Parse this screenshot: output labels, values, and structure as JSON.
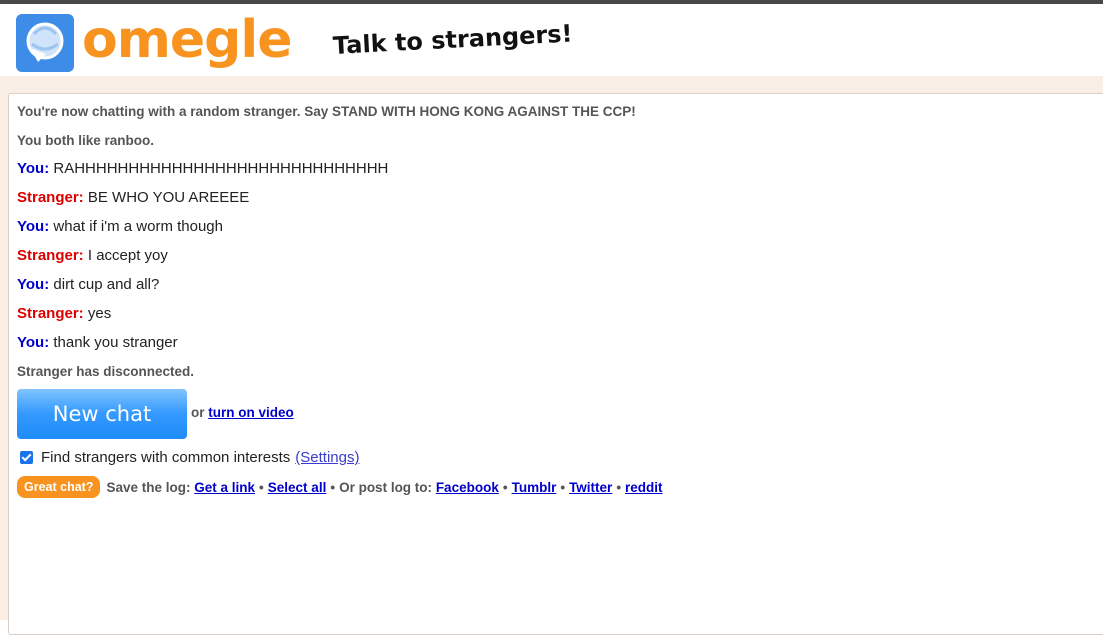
{
  "header": {
    "logo_text": "omegle",
    "tagline": "Talk to strangers!",
    "colors": {
      "logo_orange": "#f7931e",
      "logo_blue": "#3d8de8"
    }
  },
  "chat": {
    "intro": "You're now chatting with a random stranger. Say STAND WITH HONG KONG AGAINST THE CCP!",
    "common": "You both like ranboo.",
    "you_label": "You:",
    "stranger_label": "Stranger:",
    "messages": [
      {
        "who": "You:",
        "text": "RAHHHHHHHHHHHHHHHHHHHHHHHHHHHHH"
      },
      {
        "who": "Stranger:",
        "text": "BE WHO YOU AREEEE"
      },
      {
        "who": "You:",
        "text": "what if i'm a worm though"
      },
      {
        "who": "Stranger:",
        "text": "I accept yoy"
      },
      {
        "who": "You:",
        "text": "dirt cup and all?"
      },
      {
        "who": "Stranger:",
        "text": "yes"
      },
      {
        "who": "You:",
        "text": "thank you stranger"
      }
    ],
    "disconnected": "Stranger has disconnected."
  },
  "controls": {
    "new_chat": "New chat",
    "or": "or",
    "turn_on_video": "turn on video",
    "interests_label": "Find strangers with common interests",
    "interests_checked": true,
    "settings": "(Settings)"
  },
  "footer": {
    "great_chat": "Great chat?",
    "save_log": "Save the log:",
    "get_link": "Get a link",
    "bullet": "•",
    "select_all": "Select all",
    "post_log": "Or post log to:",
    "facebook": "Facebook",
    "tumblr": "Tumblr",
    "twitter": "Twitter",
    "reddit": "reddit"
  }
}
